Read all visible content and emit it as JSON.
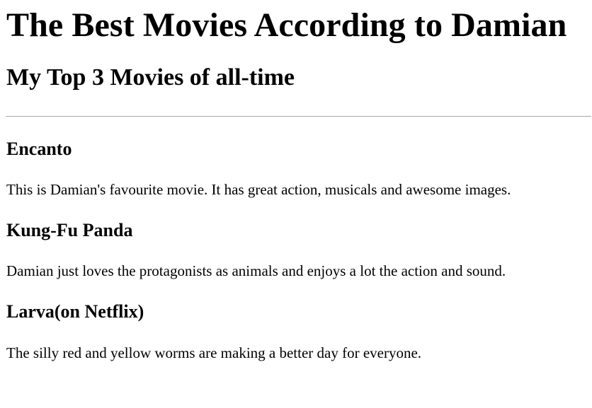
{
  "page": {
    "title": "The Best Movies According to Damian",
    "subtitle": "My Top 3 Movies of all-time"
  },
  "movies": [
    {
      "title": "Encanto",
      "description": "This is Damian's favourite movie. It has great action, musicals and awesome images."
    },
    {
      "title": "Kung-Fu Panda",
      "description": "Damian just loves the protagonists as animals and enjoys a lot the action and sound."
    },
    {
      "title": "Larva(on Netflix)",
      "description": "The silly red and yellow worms are making a better day for everyone."
    }
  ]
}
